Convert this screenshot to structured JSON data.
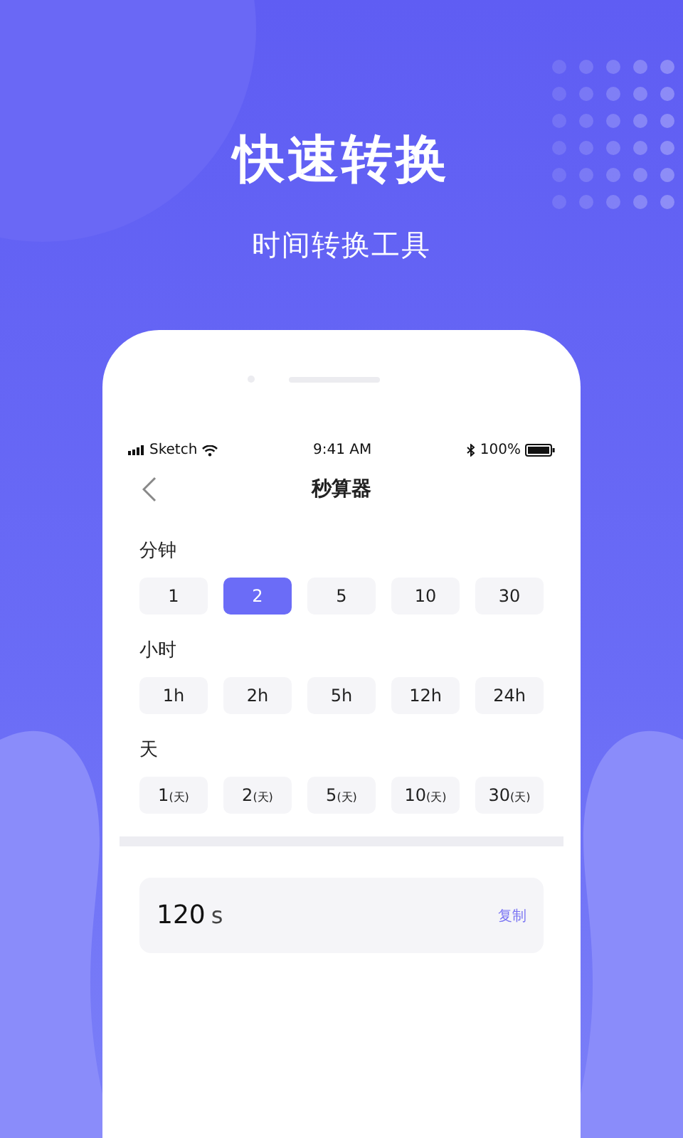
{
  "headline": "快速转换",
  "subheadline": "时间转换工具",
  "status_bar": {
    "carrier": "Sketch",
    "time": "9:41 AM",
    "battery": "100%"
  },
  "nav": {
    "title": "秒算器"
  },
  "groups": [
    {
      "label": "分钟",
      "options": [
        {
          "label": "1",
          "selected": false
        },
        {
          "label": "2",
          "selected": true
        },
        {
          "label": "5",
          "selected": false
        },
        {
          "label": "10",
          "selected": false
        },
        {
          "label": "30",
          "selected": false
        }
      ]
    },
    {
      "label": "小时",
      "options": [
        {
          "label": "1h",
          "selected": false
        },
        {
          "label": "2h",
          "selected": false
        },
        {
          "label": "5h",
          "selected": false
        },
        {
          "label": "12h",
          "selected": false
        },
        {
          "label": "24h",
          "selected": false
        }
      ]
    },
    {
      "label": "天",
      "options": [
        {
          "label": "1",
          "unit": "(天)",
          "selected": false
        },
        {
          "label": "2",
          "unit": "(天)",
          "selected": false
        },
        {
          "label": "5",
          "unit": "(天)",
          "selected": false
        },
        {
          "label": "10",
          "unit": "(天)",
          "selected": false
        },
        {
          "label": "30",
          "unit": "(天)",
          "selected": false
        }
      ]
    }
  ],
  "result": {
    "value": "120",
    "unit": "s",
    "copy": "复制"
  }
}
